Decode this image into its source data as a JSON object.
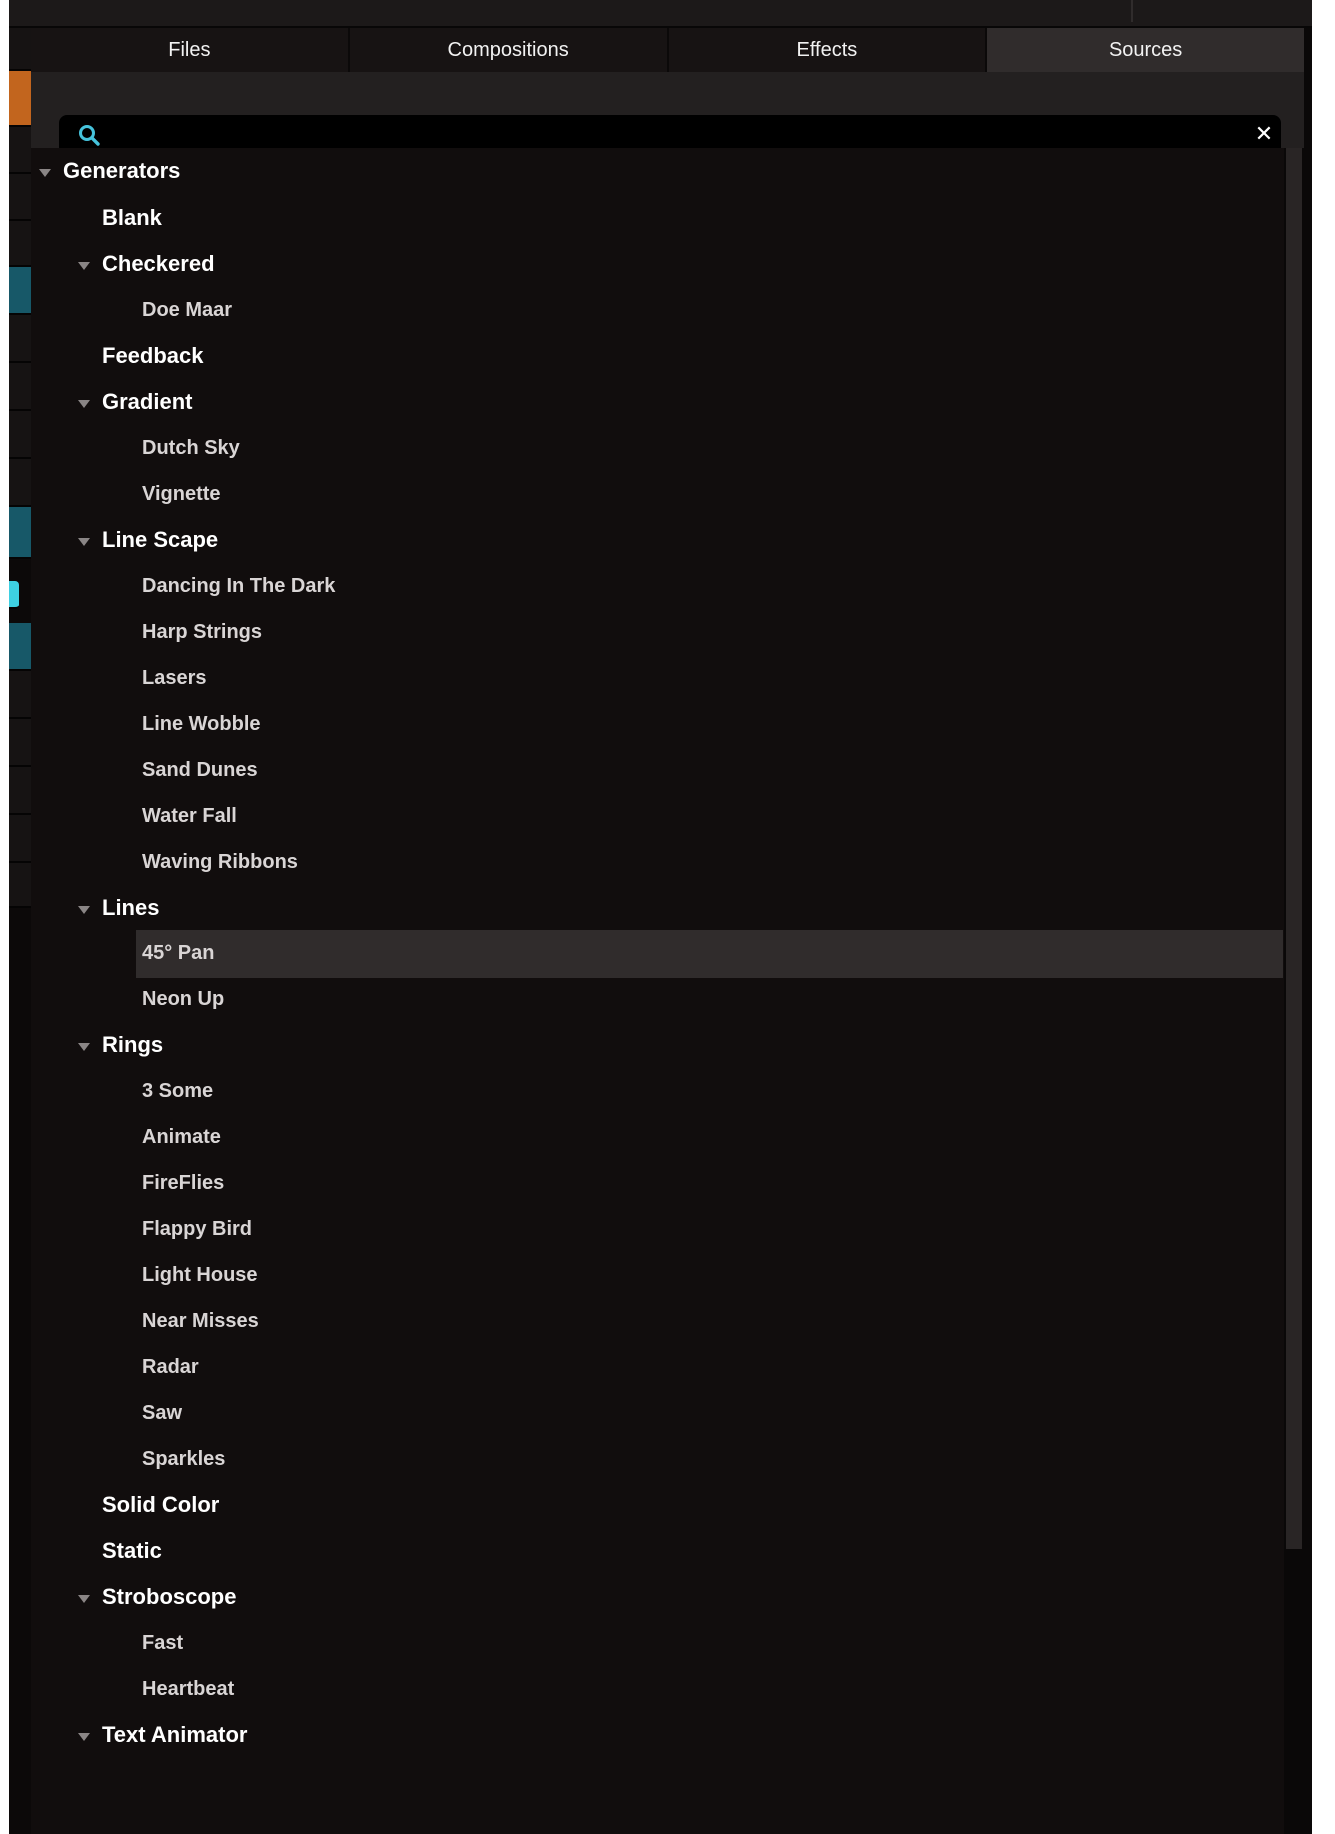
{
  "tabs": [
    {
      "label": "Files",
      "active": false
    },
    {
      "label": "Compositions",
      "active": false
    },
    {
      "label": "Effects",
      "active": false
    },
    {
      "label": "Sources",
      "active": true
    }
  ],
  "search": {
    "value": "",
    "placeholder": "",
    "icon": "search-icon",
    "clear_icon": "close-icon",
    "clear_glyph": "✕"
  },
  "colors": {
    "panel_bg": "#110d0d",
    "tab_bg": "#171313",
    "tab_active_bg": "#302c2c",
    "search_icon": "#46c3dc",
    "selected_row_bg": "#302c2c",
    "accent_orange": "#c2651e",
    "accent_cyan": "#3ed0e2"
  },
  "tree": [
    {
      "label": "Generators",
      "level": 0,
      "expanded": true,
      "selected": false
    },
    {
      "label": "Blank",
      "level": 1,
      "expanded": null,
      "selected": false
    },
    {
      "label": "Checkered",
      "level": 1,
      "expanded": true,
      "selected": false
    },
    {
      "label": "Doe Maar",
      "level": 2,
      "expanded": null,
      "selected": false
    },
    {
      "label": "Feedback",
      "level": 1,
      "expanded": null,
      "selected": false
    },
    {
      "label": "Gradient",
      "level": 1,
      "expanded": true,
      "selected": false
    },
    {
      "label": "Dutch Sky",
      "level": 2,
      "expanded": null,
      "selected": false
    },
    {
      "label": "Vignette",
      "level": 2,
      "expanded": null,
      "selected": false
    },
    {
      "label": "Line Scape",
      "level": 1,
      "expanded": true,
      "selected": false
    },
    {
      "label": "Dancing In The Dark",
      "level": 2,
      "expanded": null,
      "selected": false
    },
    {
      "label": "Harp Strings",
      "level": 2,
      "expanded": null,
      "selected": false
    },
    {
      "label": "Lasers",
      "level": 2,
      "expanded": null,
      "selected": false
    },
    {
      "label": "Line Wobble",
      "level": 2,
      "expanded": null,
      "selected": false
    },
    {
      "label": "Sand Dunes",
      "level": 2,
      "expanded": null,
      "selected": false
    },
    {
      "label": "Water Fall",
      "level": 2,
      "expanded": null,
      "selected": false
    },
    {
      "label": "Waving Ribbons",
      "level": 2,
      "expanded": null,
      "selected": false
    },
    {
      "label": "Lines",
      "level": 1,
      "expanded": true,
      "selected": false
    },
    {
      "label": "45° Pan",
      "level": 2,
      "expanded": null,
      "selected": true
    },
    {
      "label": "Neon Up",
      "level": 2,
      "expanded": null,
      "selected": false
    },
    {
      "label": "Rings",
      "level": 1,
      "expanded": true,
      "selected": false
    },
    {
      "label": "3 Some",
      "level": 2,
      "expanded": null,
      "selected": false
    },
    {
      "label": "Animate",
      "level": 2,
      "expanded": null,
      "selected": false
    },
    {
      "label": "FireFlies",
      "level": 2,
      "expanded": null,
      "selected": false
    },
    {
      "label": "Flappy Bird",
      "level": 2,
      "expanded": null,
      "selected": false
    },
    {
      "label": "Light House",
      "level": 2,
      "expanded": null,
      "selected": false
    },
    {
      "label": "Near Misses",
      "level": 2,
      "expanded": null,
      "selected": false
    },
    {
      "label": "Radar",
      "level": 2,
      "expanded": null,
      "selected": false
    },
    {
      "label": "Saw",
      "level": 2,
      "expanded": null,
      "selected": false
    },
    {
      "label": "Sparkles",
      "level": 2,
      "expanded": null,
      "selected": false
    },
    {
      "label": "Solid Color",
      "level": 1,
      "expanded": null,
      "selected": false
    },
    {
      "label": "Static",
      "level": 1,
      "expanded": null,
      "selected": false
    },
    {
      "label": "Stroboscope",
      "level": 1,
      "expanded": true,
      "selected": false
    },
    {
      "label": "Fast",
      "level": 2,
      "expanded": null,
      "selected": false
    },
    {
      "label": "Heartbeat",
      "level": 2,
      "expanded": null,
      "selected": false
    },
    {
      "label": "Text Animator",
      "level": 1,
      "expanded": true,
      "selected": false
    }
  ]
}
